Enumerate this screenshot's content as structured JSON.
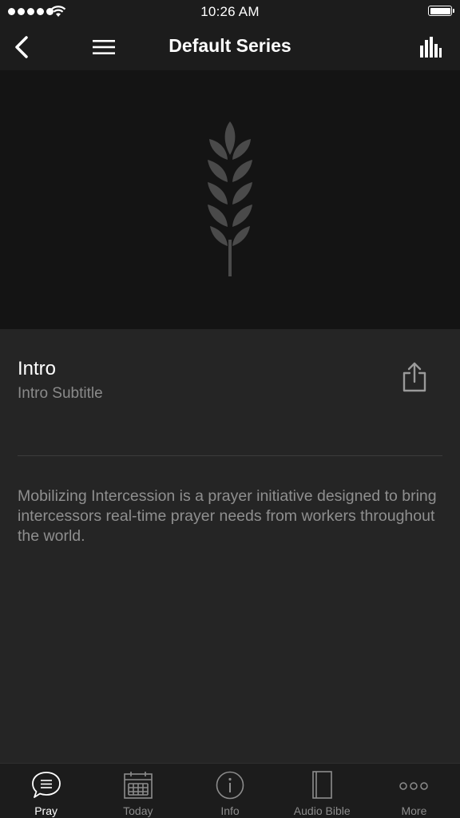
{
  "status_bar": {
    "time": "10:26 AM"
  },
  "nav": {
    "title": "Default Series",
    "back_icon": "chevron-left-icon",
    "menu_icon": "hamburger-menu-icon",
    "stats_icon": "bar-chart-icon"
  },
  "hero": {
    "logo_icon": "wheat-icon"
  },
  "item": {
    "title": "Intro",
    "subtitle": "Intro Subtitle",
    "share_icon": "share-icon",
    "description": "Mobilizing Intercession is a prayer initiative designed to bring intercessors real-time prayer needs from workers throughout the world."
  },
  "tabs": [
    {
      "label": "Pray",
      "icon": "speech-bubble-icon",
      "active": true
    },
    {
      "label": "Today",
      "icon": "calendar-icon",
      "active": false
    },
    {
      "label": "Info",
      "icon": "info-icon",
      "active": false
    },
    {
      "label": "Audio Bible",
      "icon": "book-icon",
      "active": false
    },
    {
      "label": "More",
      "icon": "more-dots-icon",
      "active": false
    }
  ],
  "colors": {
    "background": "#252525",
    "hero_background": "#141414",
    "bar_background": "#1c1c1c",
    "text_secondary": "#8c8c8c"
  }
}
